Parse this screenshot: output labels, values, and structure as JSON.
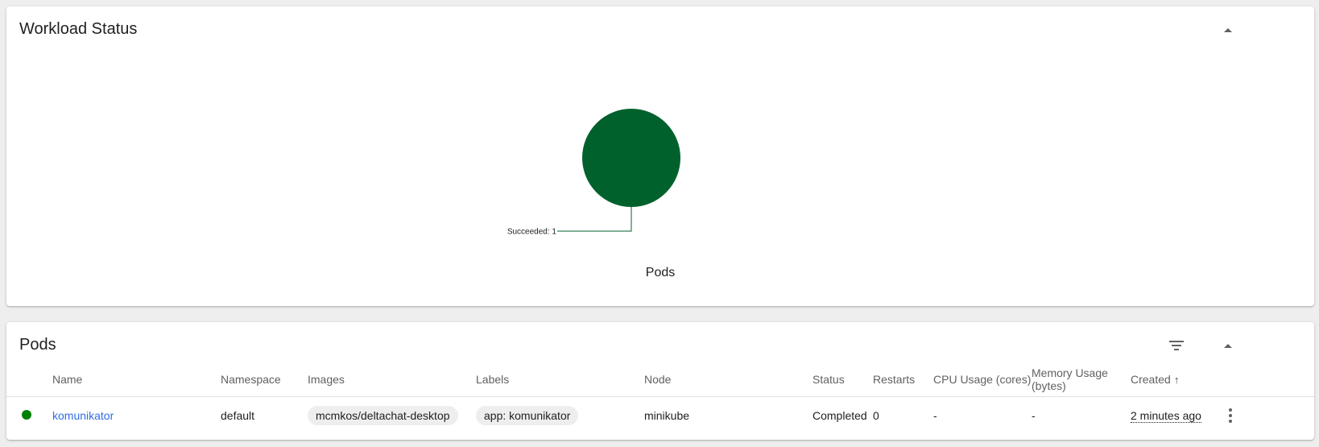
{
  "workload_status": {
    "title": "Workload Status",
    "collapse_icon": "arrow-drop-up-icon"
  },
  "chart_data": {
    "type": "pie",
    "title": "Pods",
    "categories": [
      "Succeeded"
    ],
    "values": [
      1
    ],
    "colors": [
      "#00612c"
    ],
    "slice_labels": [
      "Succeeded: 1"
    ]
  },
  "pods": {
    "title": "Pods",
    "filter_icon": "filter-list-icon",
    "collapse_icon": "arrow-drop-up-icon",
    "columns": {
      "name": "Name",
      "namespace": "Namespace",
      "images": "Images",
      "labels": "Labels",
      "node": "Node",
      "status": "Status",
      "restarts": "Restarts",
      "cpu": "CPU Usage (cores)",
      "memory_line1": "Memory Usage",
      "memory_line2": "(bytes)",
      "created": "Created",
      "created_sort": "↑"
    },
    "rows": [
      {
        "status_color": "#008000",
        "name": "komunikator",
        "namespace": "default",
        "image": "mcmkos/deltachat-desktop",
        "label": "app: komunikator",
        "node": "minikube",
        "status": "Completed",
        "restarts": "0",
        "cpu": "-",
        "memory": "-",
        "created": "2 minutes ago",
        "menu_icon": "more-vert-icon"
      }
    ]
  }
}
